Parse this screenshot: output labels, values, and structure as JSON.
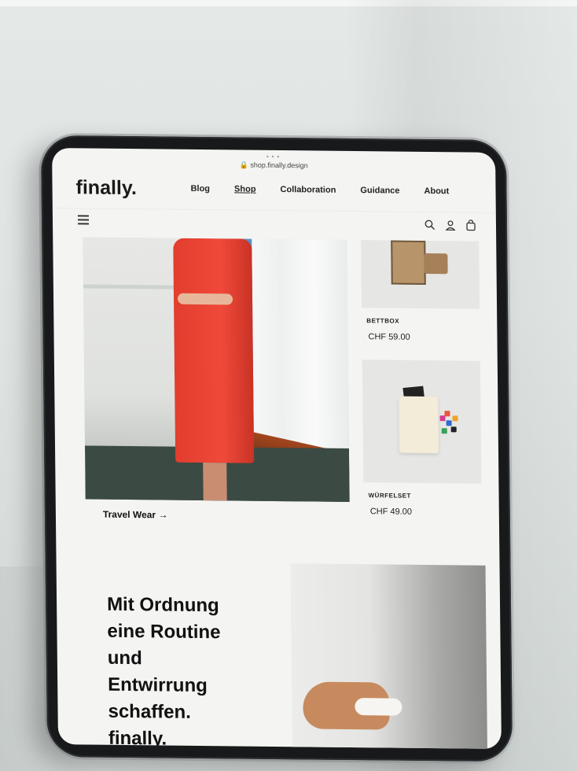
{
  "browser": {
    "dots": "•••",
    "url": "🔒 shop.finally.design"
  },
  "header": {
    "logo": "finally.",
    "nav": [
      {
        "label": "Blog"
      },
      {
        "label": "Shop",
        "active": true
      },
      {
        "label": "Collaboration"
      },
      {
        "label": "Guidance"
      },
      {
        "label": "About"
      }
    ]
  },
  "toolbar": {
    "icons": [
      "menu-icon",
      "search-icon",
      "account-icon",
      "cart-icon"
    ]
  },
  "hero": {
    "caption": "Travel Wear →"
  },
  "products": [
    {
      "title": "BETTBOX",
      "price": "CHF 59.00"
    },
    {
      "title": "WÜRFELSET",
      "price": "CHF 49.00"
    }
  ],
  "tagline": [
    "Mit Ordnung",
    "eine Routine",
    "und",
    "Entwirrung",
    "schaffen.",
    "finally."
  ],
  "colors": {
    "accent_red": "#e23d2e",
    "text": "#111111",
    "screen_bg": "#f4f4f2"
  }
}
